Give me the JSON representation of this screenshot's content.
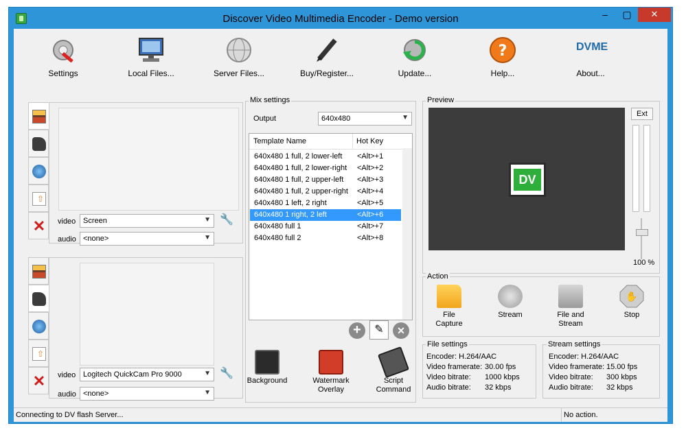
{
  "window": {
    "title": "Discover Video Multimedia Encoder - Demo version",
    "min": "–",
    "max": "▢",
    "close": "✕"
  },
  "toolbar": [
    {
      "label": "Settings",
      "icon": "settings-icon"
    },
    {
      "label": "Local Files...",
      "icon": "monitor-icon"
    },
    {
      "label": "Server Files...",
      "icon": "globe-icon"
    },
    {
      "label": "Buy/Register...",
      "icon": "pen-icon"
    },
    {
      "label": "Update...",
      "icon": "update-icon"
    },
    {
      "label": "Help...",
      "icon": "help-icon"
    },
    {
      "label": "About...",
      "logo": "DVME"
    }
  ],
  "source1": {
    "video_label": "video",
    "video_value": "Screen",
    "audio_label": "audio",
    "audio_value": "<none>"
  },
  "source2": {
    "video_label": "video",
    "video_value": "Logitech QuickCam Pro 9000",
    "audio_label": "audio",
    "audio_value": "<none>"
  },
  "mix": {
    "title": "Mix settings",
    "output_label": "Output",
    "output_value": "640x480",
    "columns": [
      "Template Name",
      "Hot Key"
    ],
    "rows": [
      [
        "640x480 1 full, 2 lower-left",
        "<Alt>+1"
      ],
      [
        "640x480 1 full, 2 lower-right",
        "<Alt>+2"
      ],
      [
        "640x480 1 full, 2 upper-left",
        "<Alt>+3"
      ],
      [
        "640x480 1 full, 2 upper-right",
        "<Alt>+4"
      ],
      [
        "640x480 1 left, 2 right",
        "<Alt>+5"
      ],
      [
        "640x480 1 right, 2 left",
        "<Alt>+6"
      ],
      [
        "640x480 full 1",
        "<Alt>+7"
      ],
      [
        "640x480 full 2",
        "<Alt>+8"
      ]
    ],
    "selected_row": 5,
    "buttons": [
      {
        "label": "Background"
      },
      {
        "label": "Watermark Overlay"
      },
      {
        "label": "Script Command"
      }
    ]
  },
  "preview": {
    "title": "Preview",
    "ext_label": "Ext",
    "zoom": "100 %",
    "logo_text": "DV"
  },
  "action": {
    "title": "Action",
    "items": [
      {
        "label": "File Capture"
      },
      {
        "label": "Stream"
      },
      {
        "label": "File and Stream"
      },
      {
        "label": "Stop"
      }
    ]
  },
  "file_settings": {
    "title": "File settings",
    "encoder": "Encoder: H.264/AAC",
    "framerate_label": "Video framerate:",
    "framerate": "30.00 fps",
    "vbitrate_label": "Video bitrate:",
    "vbitrate": "1000 kbps",
    "abitrate_label": "Audio bitrate:",
    "abitrate": "32 kbps"
  },
  "stream_settings": {
    "title": "Stream settings",
    "encoder": "Encoder: H.264/AAC",
    "framerate_label": "Video framerate:",
    "framerate": "15.00 fps",
    "vbitrate_label": "Video bitrate:",
    "vbitrate": "300 kbps",
    "abitrate_label": "Audio bitrate:",
    "abitrate": "32 kbps"
  },
  "status": {
    "left": "Connecting to DV flash Server...",
    "right": "No action."
  },
  "colors": {
    "titlebar": "#2e95d8",
    "selection": "#3399ff",
    "close": "#c7392b"
  }
}
